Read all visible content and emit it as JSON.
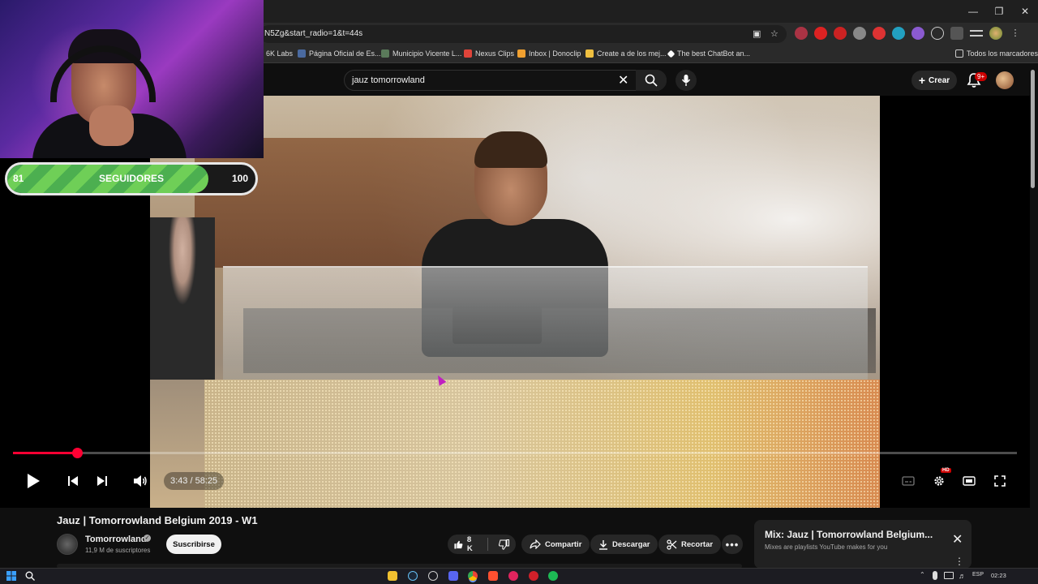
{
  "browser": {
    "url": "N5Zg&start_radio=1&t=44s",
    "bookmarks": [
      {
        "label": "6K Labs",
        "color": "#3a3a3a"
      },
      {
        "label": "Página Oficial de Es...",
        "color": "#4a6aa0"
      },
      {
        "label": "Municipio Vicente L...",
        "color": "#5a7a5a"
      },
      {
        "label": "Nexus Clips",
        "color": "#e0443a"
      },
      {
        "label": "Inbox | Donoclip",
        "color": "#f0a030"
      },
      {
        "label": "Create a de los mej...",
        "color": "#f0c040"
      },
      {
        "label": "The best ChatBot an...",
        "color": "#ffffff"
      }
    ],
    "all_bookmarks": "Todos los marcadores"
  },
  "youtube": {
    "search_value": "jauz tomorrowland",
    "create_label": "Crear",
    "notifications_badge": "9+"
  },
  "overlay": {
    "goal_current": "81",
    "goal_label": "SEGUIDORES",
    "goal_target": "100",
    "goal_progress": 0.81
  },
  "player": {
    "time": "3:43 / 58:25",
    "progress": 0.064,
    "hd_badge": "HD"
  },
  "video": {
    "title": "Jauz | Tomorrowland Belgium 2019 - W1",
    "channel": "Tomorrowland",
    "subscribers": "11,9 M de suscriptores",
    "subscribe_label": "Suscribirse",
    "likes": "8 K",
    "share_label": "Compartir",
    "download_label": "Descargar",
    "clip_label": "Recortar"
  },
  "mix": {
    "title": "Mix: Jauz | Tomorrowland Belgium...",
    "subtitle": "Mixes are playlists YouTube makes for you"
  },
  "taskbar": {
    "language": "ESP",
    "time": "02:23"
  },
  "colors": {
    "accent_red": "#ff0033",
    "goal_green": "#4caf50"
  }
}
